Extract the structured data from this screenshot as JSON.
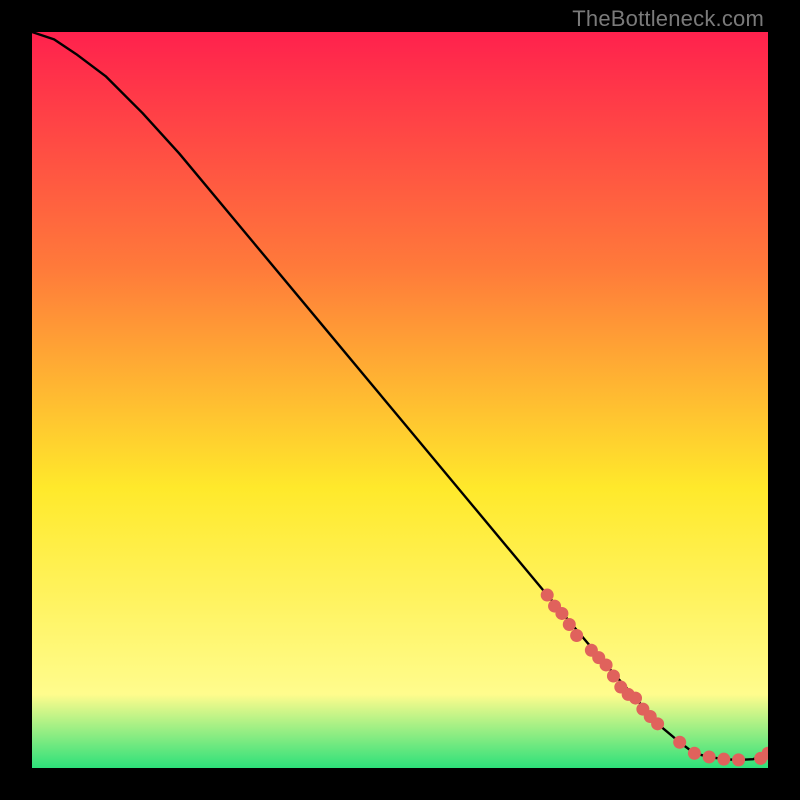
{
  "attribution": "TheBottleneck.com",
  "colors": {
    "frame": "#000000",
    "gradient_top": "#ff214d",
    "gradient_mid_upper": "#ff7a3a",
    "gradient_mid": "#ffe92b",
    "gradient_lower": "#fffc8d",
    "gradient_bottom": "#2de07a",
    "curve": "#000000",
    "marker": "#e0625c"
  },
  "chart_data": {
    "type": "line",
    "title": "",
    "xlabel": "",
    "ylabel": "",
    "xlim": [
      0,
      100
    ],
    "ylim": [
      0,
      100
    ],
    "series": [
      {
        "name": "bottleneck-curve",
        "x": [
          0,
          3,
          6,
          10,
          15,
          20,
          30,
          40,
          50,
          60,
          70,
          78,
          82,
          85,
          88,
          90,
          92,
          94,
          96,
          98,
          100
        ],
        "y": [
          100,
          99,
          97,
          94,
          89,
          83.5,
          71.5,
          59.5,
          47.5,
          35.5,
          23.5,
          14,
          9.5,
          6,
          3.5,
          2,
          1.5,
          1.2,
          1.1,
          1.2,
          2
        ]
      }
    ],
    "markers": {
      "name": "highlighted-points",
      "x": [
        70,
        71,
        72,
        73,
        74,
        76,
        77,
        78,
        79,
        80,
        81,
        82,
        83,
        84,
        85,
        88,
        90,
        92,
        94,
        96,
        99,
        100
      ],
      "y": [
        23.5,
        22,
        21,
        19.5,
        18,
        16,
        15,
        14,
        12.5,
        11,
        10,
        9.5,
        8,
        7,
        6,
        3.5,
        2,
        1.5,
        1.2,
        1.1,
        1.3,
        2
      ]
    }
  }
}
